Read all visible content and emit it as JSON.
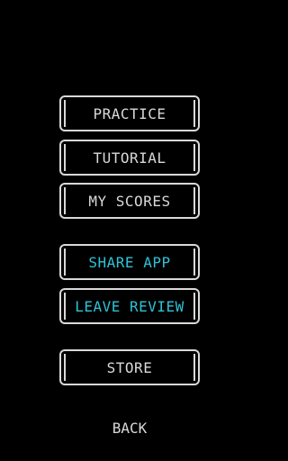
{
  "menu": {
    "practice_label": "PRACTICE",
    "tutorial_label": "TUTORIAL",
    "my_scores_label": "MY SCORES",
    "share_app_label": "SHARE APP",
    "leave_review_label": "LEAVE REVIEW",
    "store_label": "STORE",
    "back_label": "BACK"
  },
  "colors": {
    "background": "#000000",
    "primary_text": "#d9d9d9",
    "accent_text": "#2ec3d6"
  }
}
